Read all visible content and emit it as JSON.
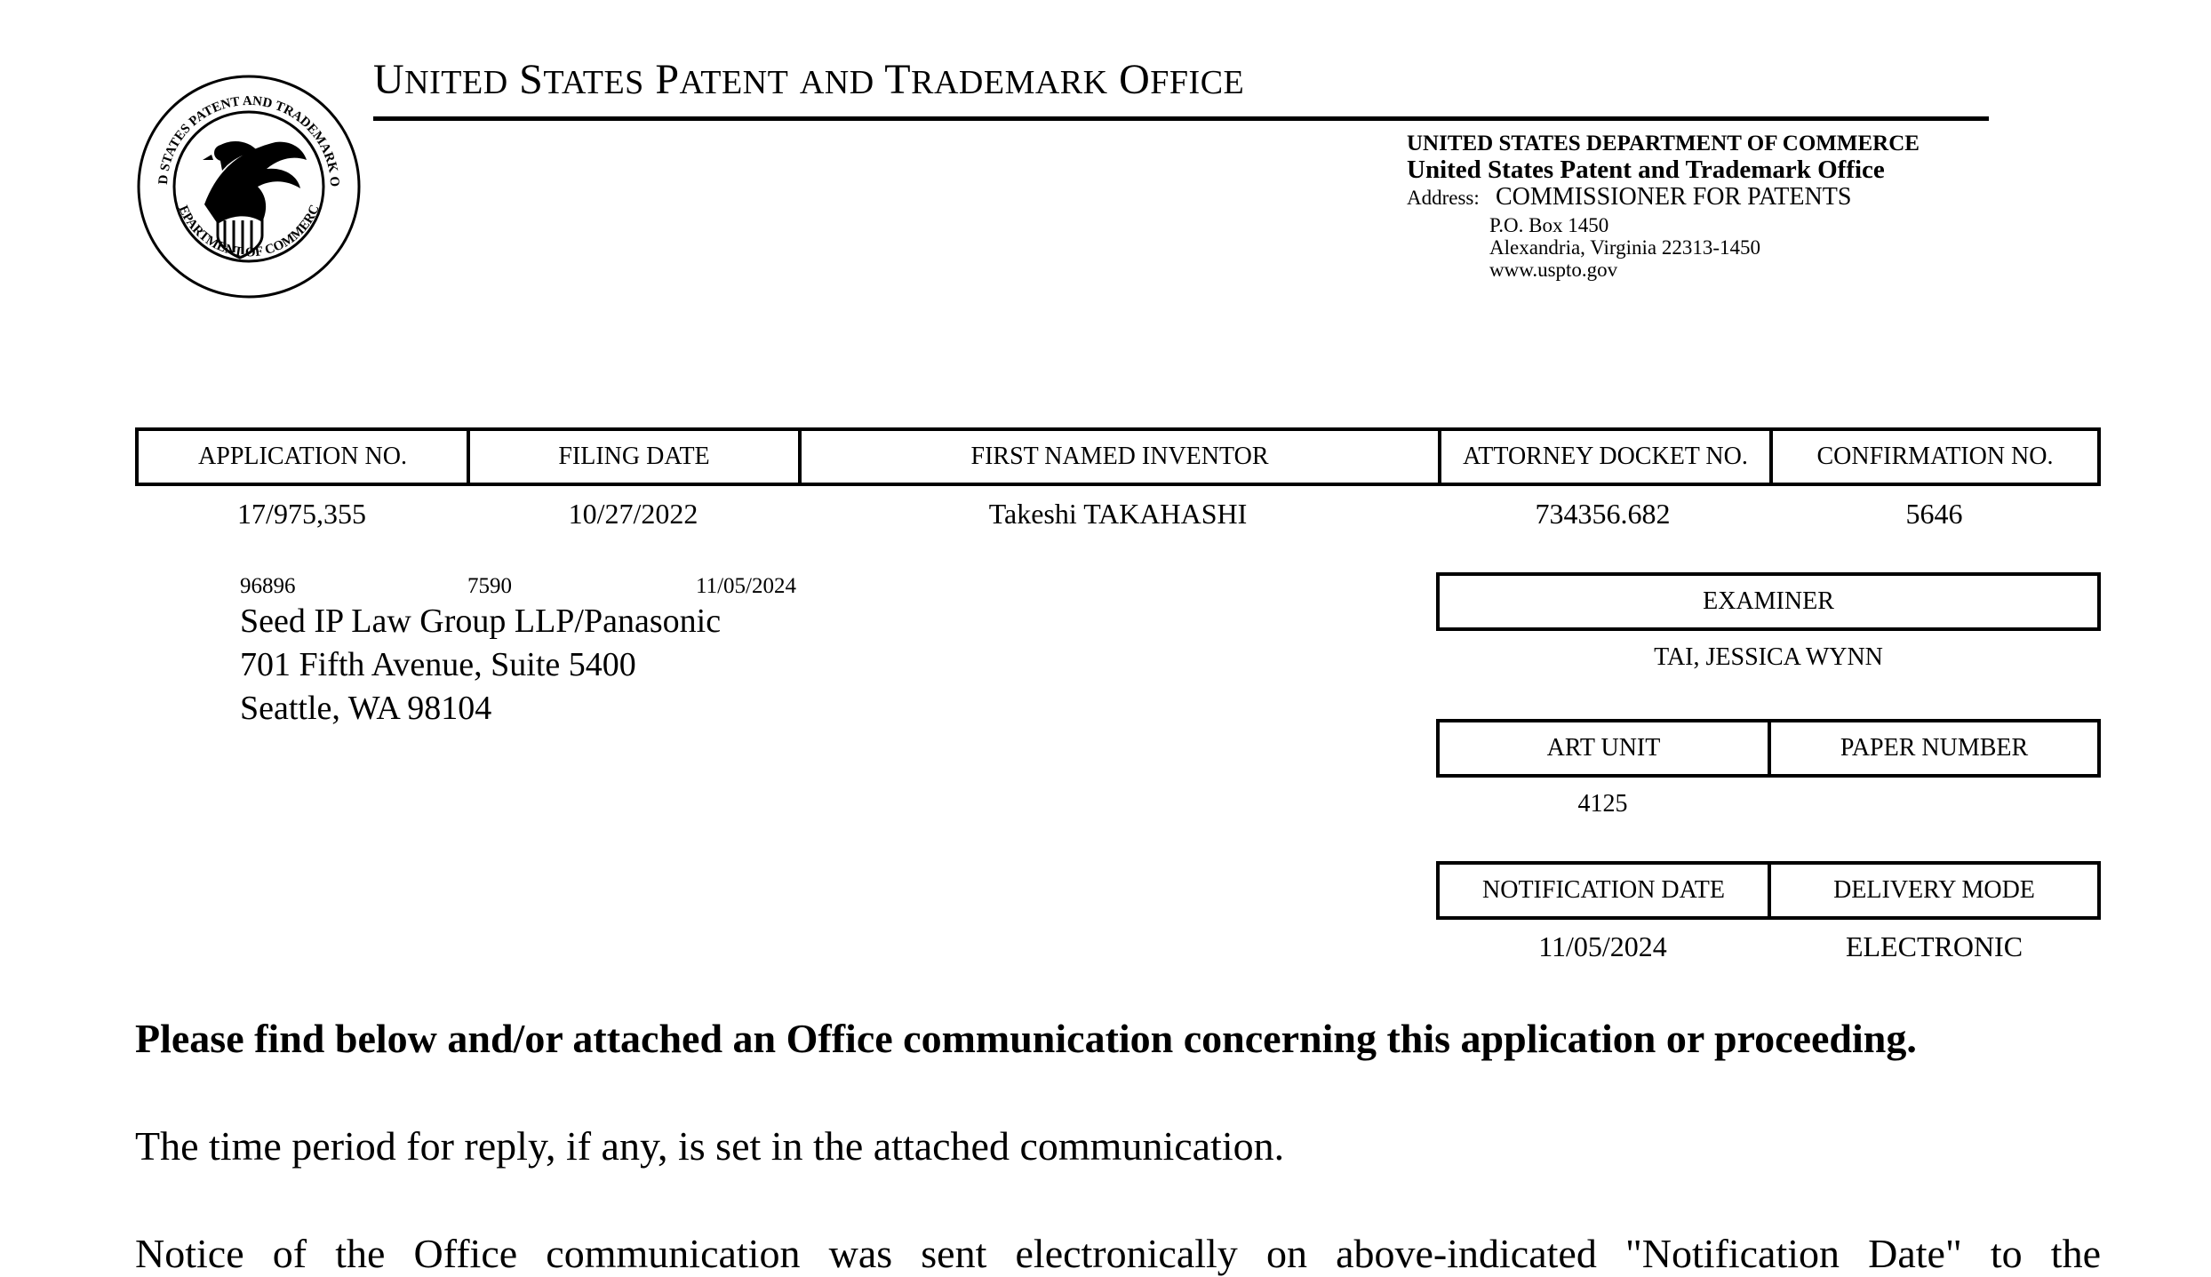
{
  "header": {
    "office_title_words": [
      {
        "cap": "U",
        "rest": "NITED"
      },
      {
        "cap": "S",
        "rest": "TATES"
      },
      {
        "cap": "P",
        "rest": "ATENT"
      },
      {
        "cap": "",
        "rest": "AND"
      },
      {
        "cap": "T",
        "rest": "RADEMARK"
      },
      {
        "cap": "O",
        "rest": "FFICE"
      }
    ],
    "seal_top_text": "UNITED STATES PATENT AND TRADEMARK OFFICE",
    "seal_bottom_text": "DEPARTMENT OF COMMERCE"
  },
  "address": {
    "department": "UNITED STATES DEPARTMENT OF COMMERCE",
    "office": "United States Patent and Trademark Office",
    "label": "Address:",
    "name": "COMMISSIONER FOR PATENTS",
    "po_box": "P.O. Box 1450",
    "city": "Alexandria, Virginia 22313-1450",
    "website": "www.uspto.gov"
  },
  "application_table": {
    "headers": {
      "application_no": "APPLICATION NO.",
      "filing_date": "FILING DATE",
      "first_named_inventor": "FIRST NAMED INVENTOR",
      "attorney_docket_no": "ATTORNEY DOCKET NO.",
      "confirmation_no": "CONFIRMATION NO."
    },
    "values": {
      "application_no": "17/975,355",
      "filing_date": "10/27/2022",
      "first_named_inventor": "Takeshi TAKAHASHI",
      "attorney_docket_no": "734356.682",
      "confirmation_no": "5646"
    }
  },
  "correspondence": {
    "customer_no": "96896",
    "code": "7590",
    "date": "11/05/2024",
    "lines": [
      "Seed IP Law Group LLP/Panasonic",
      "701 Fifth Avenue, Suite 5400",
      "Seattle, WA 98104"
    ]
  },
  "examiner": {
    "header": "EXAMINER",
    "name": "TAI, JESSICA WYNN"
  },
  "art_unit": {
    "art_unit_header": "ART UNIT",
    "paper_number_header": "PAPER NUMBER",
    "art_unit_value": "4125",
    "paper_number_value": ""
  },
  "notification": {
    "date_header": "NOTIFICATION DATE",
    "mode_header": "DELIVERY MODE",
    "date_value": "11/05/2024",
    "mode_value": "ELECTRONIC"
  },
  "body": {
    "notice_bold": "Please find below and/or attached an Office communication concerning this application or proceeding.",
    "reply_period": "The time period for reply, if any, is set in the attached communication.",
    "electronic_notice": "Notice of the Office communication was sent electronically on above-indicated \"Notification Date\" to the"
  }
}
